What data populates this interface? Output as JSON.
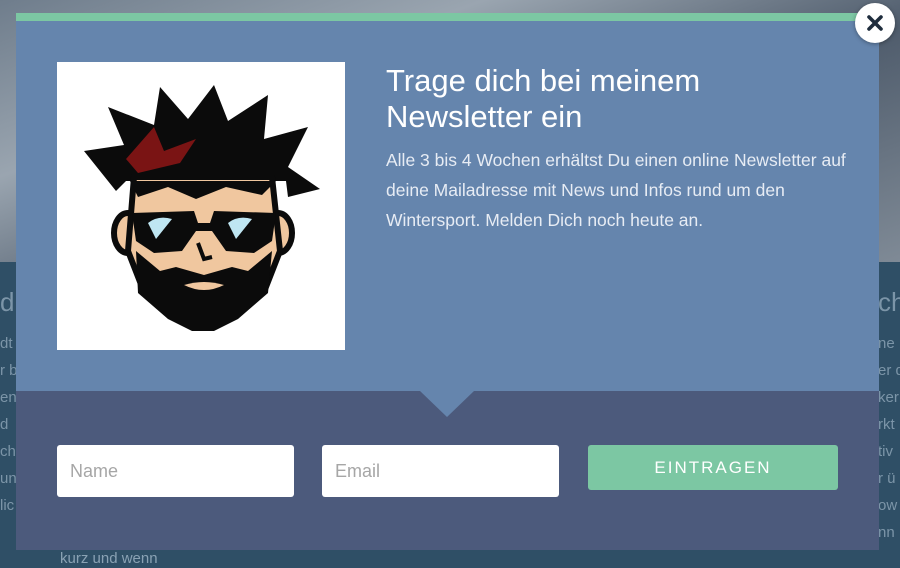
{
  "background": {
    "left_heading": "d",
    "right_heading": "ch",
    "left_text_lines": [
      "dt",
      "r b",
      "en",
      "d",
      "ch",
      "un",
      "lic"
    ],
    "right_text_lines": [
      "ne",
      "er d",
      "ker",
      "rkt",
      "tiv",
      "r ü",
      "ow",
      "nn"
    ],
    "footer_text": "kurz und wenn"
  },
  "modal": {
    "accent_color": "#7cc7a3",
    "top_color": "#6585ad",
    "bottom_color": "#4c5a7c",
    "avatar_icon": "bearded-sunglasses-avatar-icon",
    "title": "Trage dich bei meinem Newsletter ein",
    "description": "Alle 3 bis 4 Wochen erhältst Du einen online Newsletter auf deine Mailadresse mit News und Infos rund um den Wintersport. Melden Dich noch heute an.",
    "form": {
      "name_placeholder": "Name",
      "email_placeholder": "Email",
      "submit_label": "EINTRAGEN"
    },
    "close_icon": "close-icon"
  }
}
